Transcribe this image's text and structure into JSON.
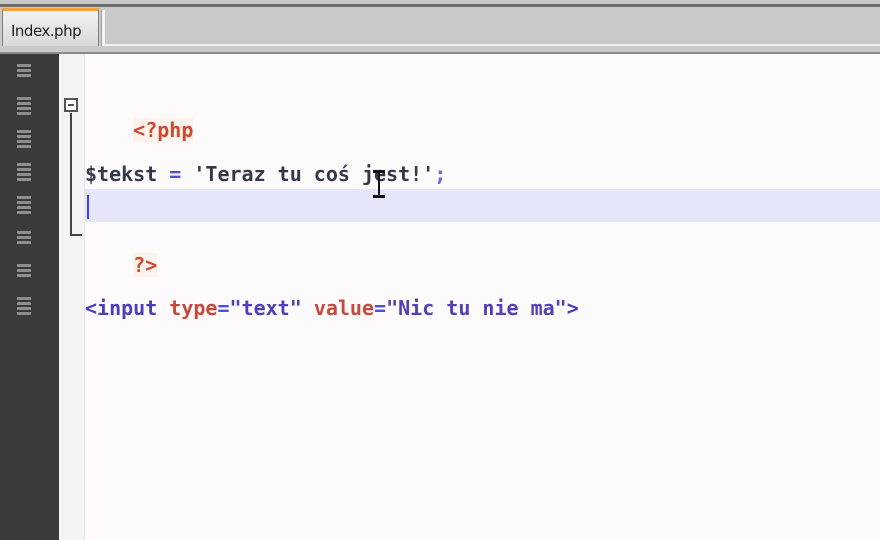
{
  "tabs": [
    {
      "label": "Index.php",
      "active": true
    }
  ],
  "code": {
    "php_open": "<?php",
    "line_tekst": {
      "var": "$tekst",
      "op": " = ",
      "str": "'Teraz tu coś jest!'",
      "semi": ";"
    },
    "php_close": "?>",
    "html_line": {
      "tag_open": "<input",
      "attr1": "type",
      "eq1": "=",
      "val1": "\"text\"",
      "attr2": "value",
      "eq2": "=",
      "val2": "\"Nic tu nie ma\"",
      "tag_close": ">"
    }
  },
  "colors": {
    "tab_accent": "#f2a43a",
    "current_line": "#e6e6fb",
    "php_delim": "#d0482e"
  },
  "icons": [
    "gutter-marker-icon",
    "gutter-marker-icon",
    "gutter-marker-icon",
    "gutter-marker-icon",
    "gutter-marker-icon",
    "gutter-marker-icon",
    "gutter-marker-icon",
    "gutter-marker-icon"
  ]
}
